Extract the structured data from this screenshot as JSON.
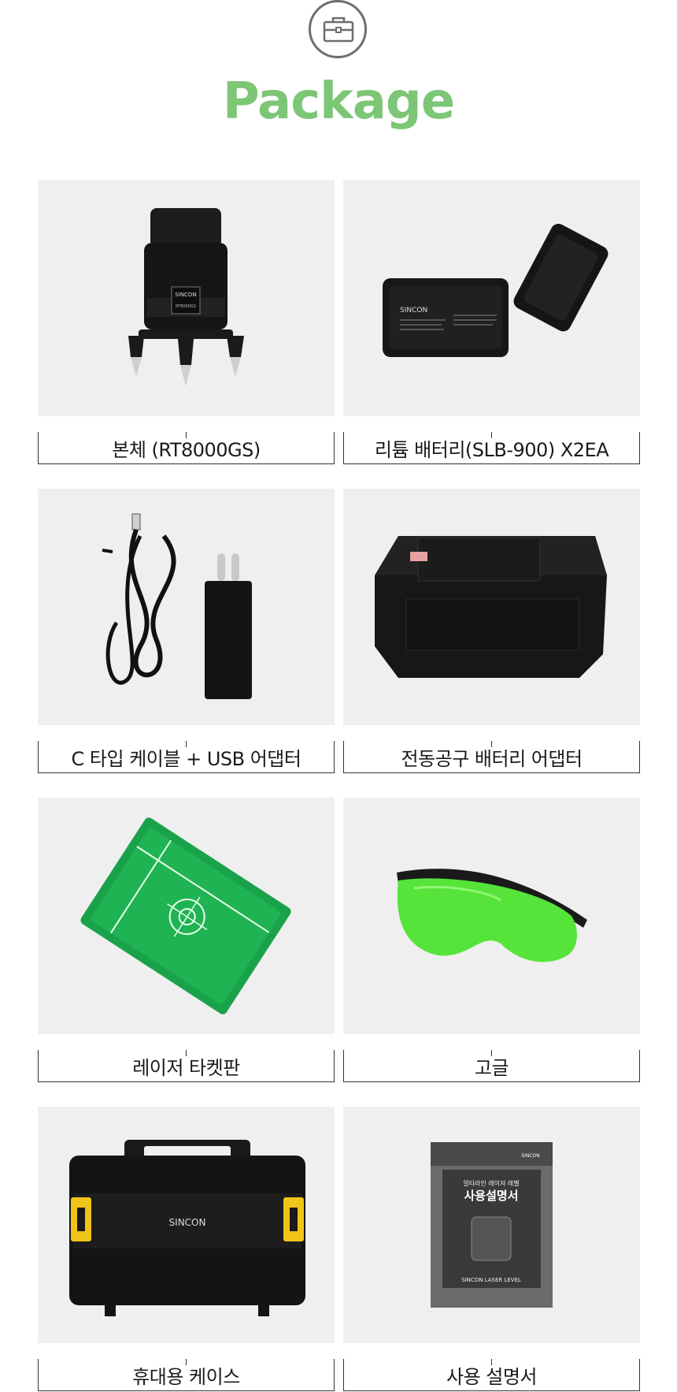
{
  "title": "Package",
  "items": [
    {
      "label": "본체 (RT8000GS)",
      "image": "laser-level-unit",
      "brand_text": "SINCON",
      "model_text": "RT8000GS"
    },
    {
      "label": "리튬 배터리(SLB-900) X2EA",
      "image": "lithium-battery",
      "brand_text": "SINCON"
    },
    {
      "label": "C 타입 케이블 + USB 어댑터",
      "image": "usb-cable-adapter"
    },
    {
      "label": "전동공구 배터리 어댑터",
      "image": "power-tool-battery-adapter"
    },
    {
      "label": "레이저 타켓판",
      "image": "laser-target-plate"
    },
    {
      "label": "고글",
      "image": "green-goggles"
    },
    {
      "label": "휴대용 케이스",
      "image": "carrying-case",
      "brand_text": "SINCON"
    },
    {
      "label": "사용 설명서",
      "image": "user-manual",
      "manual_title": "사용설명서",
      "manual_subtitle": "멀티라인 레이저 레벨",
      "manual_footer": "SINCON LASER LEVEL",
      "brand_text": "SINCON"
    }
  ],
  "colors": {
    "accent": "#7cc676",
    "card_bg": "#efefef"
  }
}
